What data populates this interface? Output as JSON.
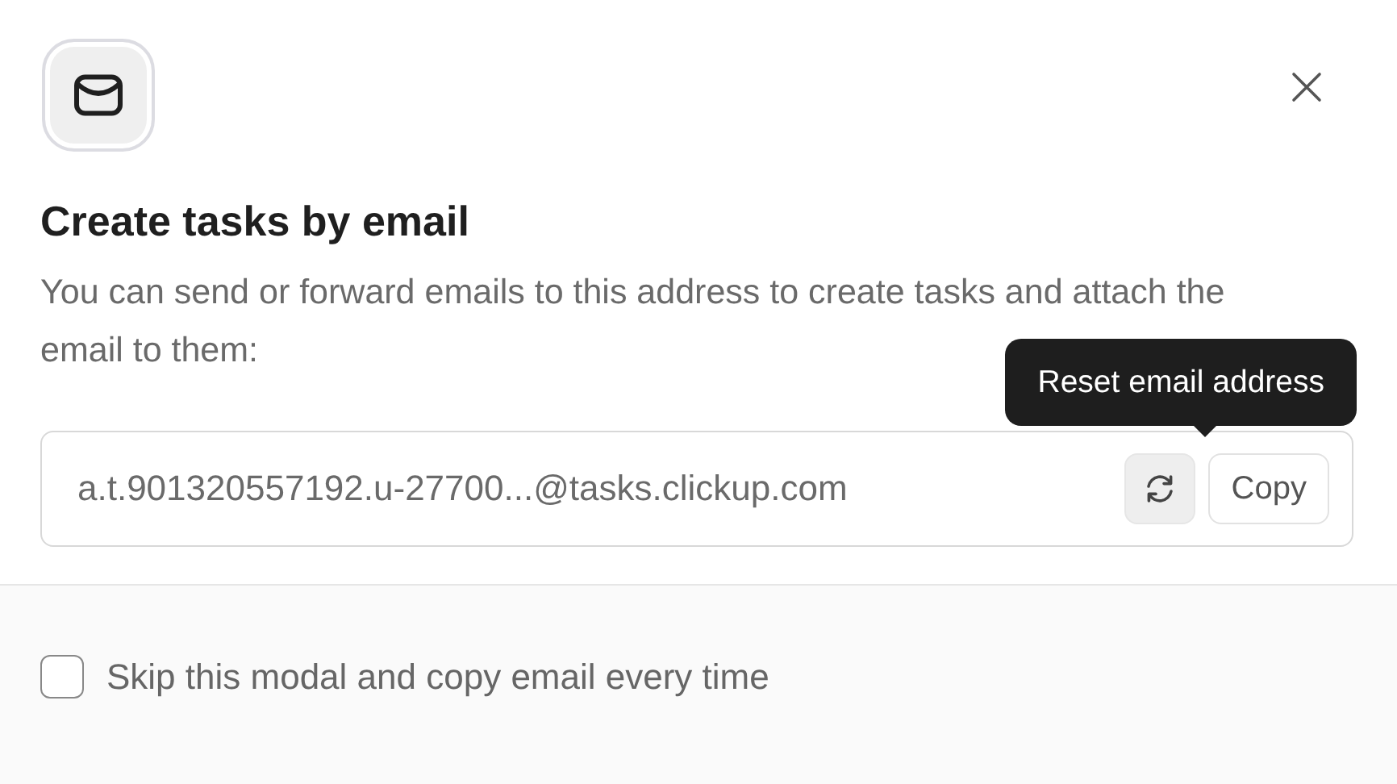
{
  "dialog": {
    "title": "Create tasks by email",
    "description": "You can send or forward emails to this address to create tasks and attach the email to them:"
  },
  "email_field": {
    "value": "a.t.901320557192.u-27700...@tasks.clickup.com"
  },
  "tooltip": "Reset email address",
  "copy_button": "Copy",
  "footer": {
    "checkbox": {
      "label": "Skip this modal and copy email every time",
      "checked": false
    }
  }
}
